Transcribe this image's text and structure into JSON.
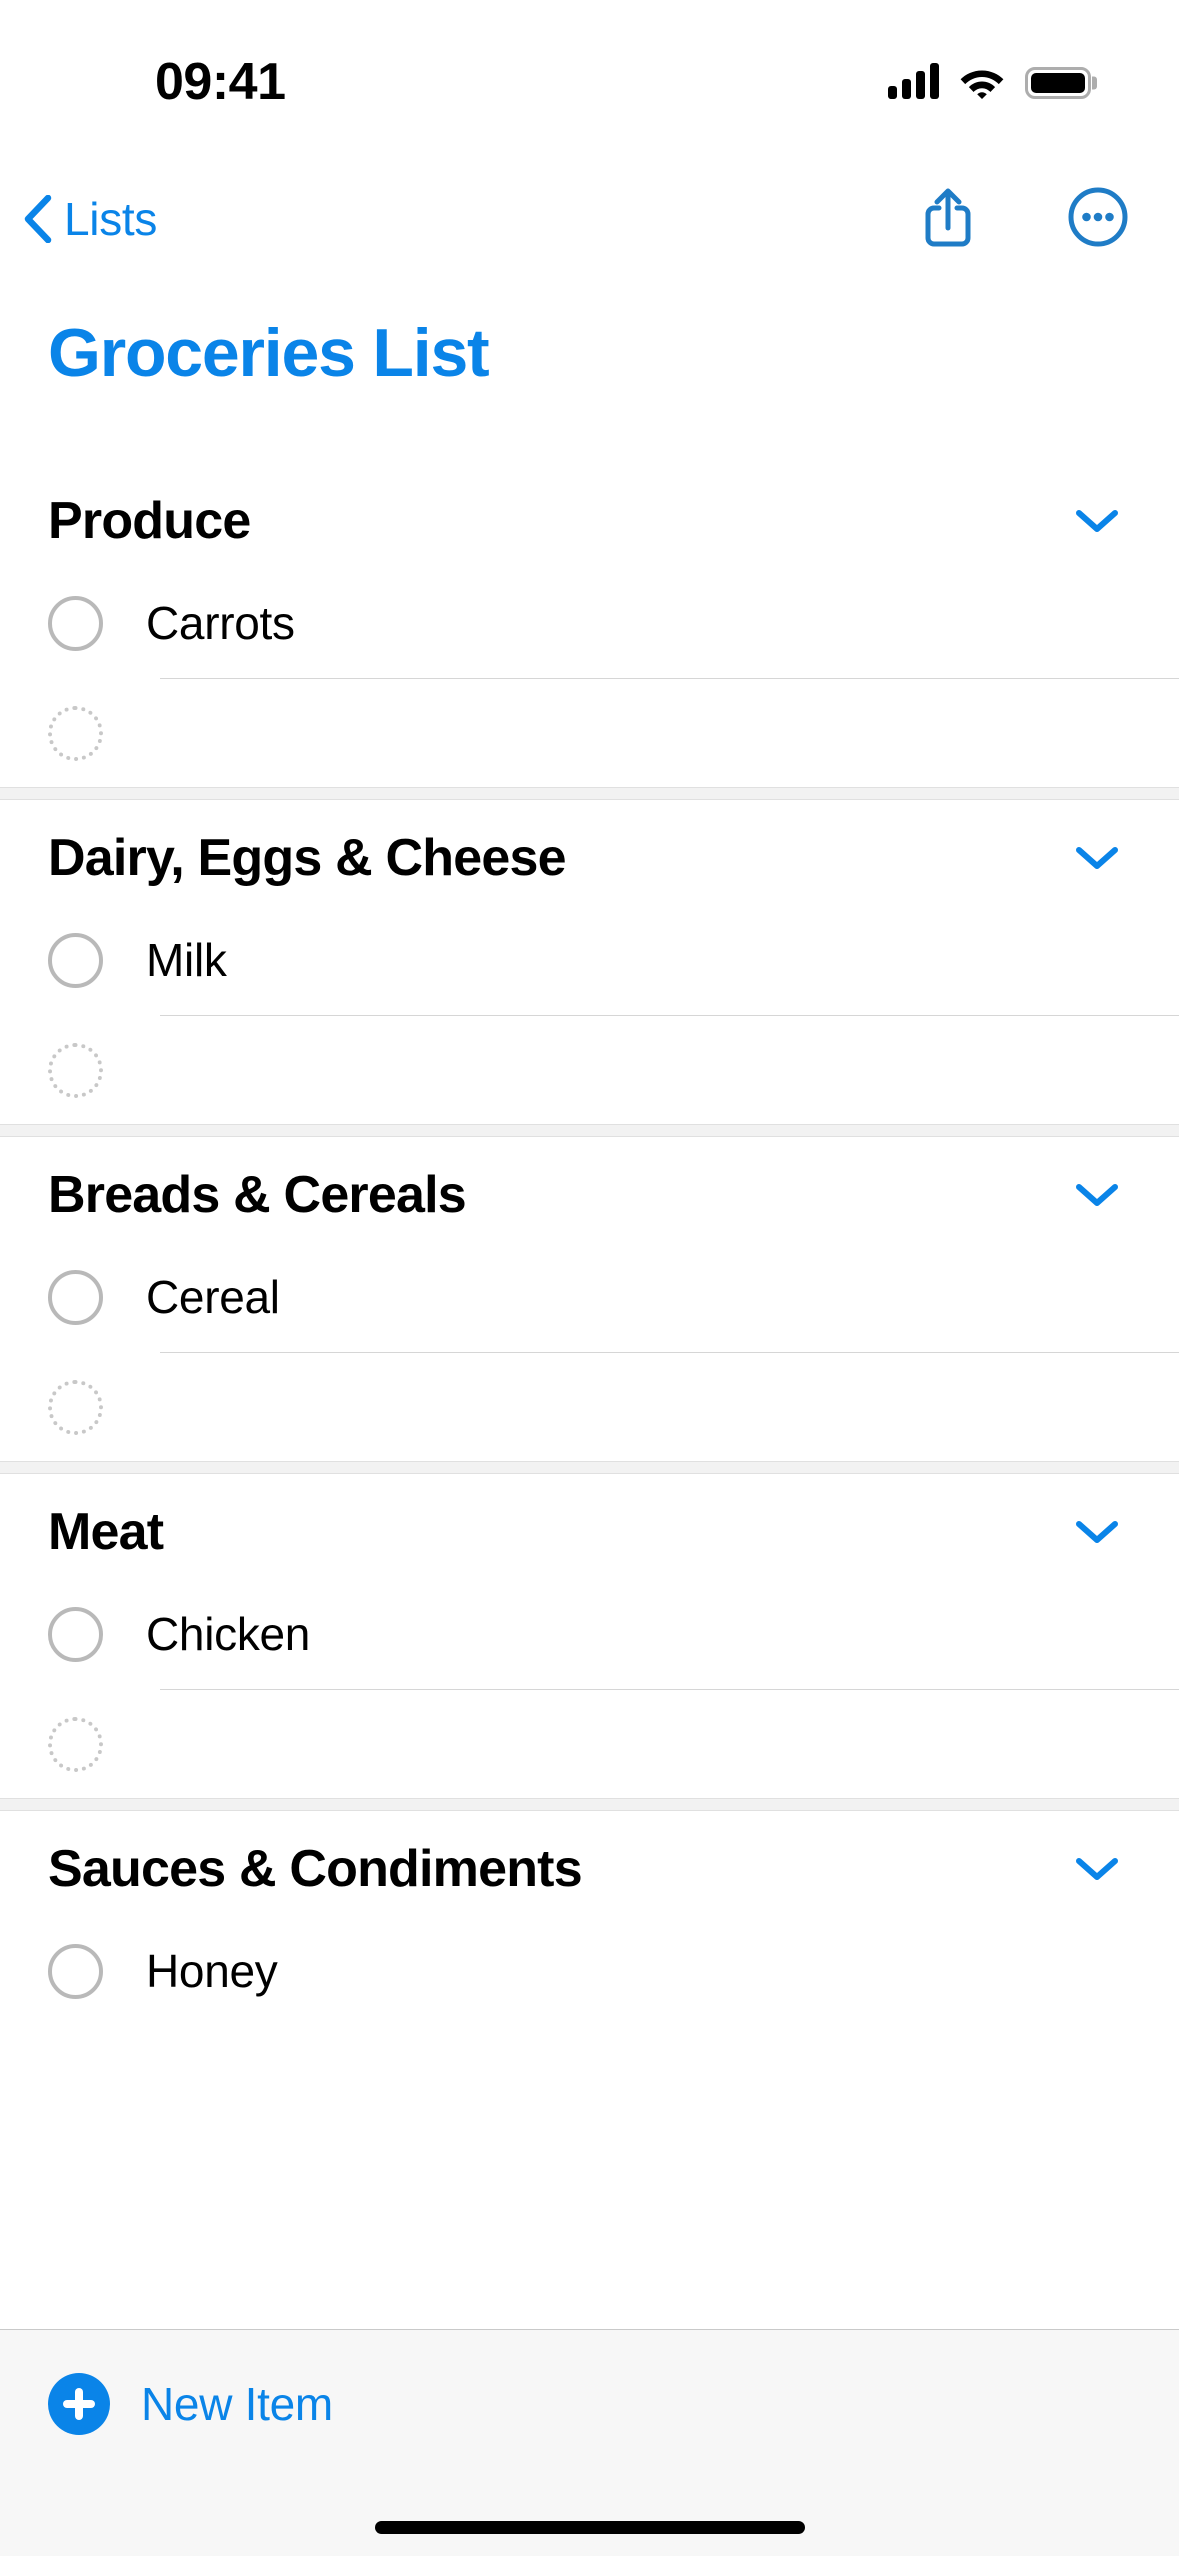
{
  "status_bar": {
    "time": "09:41",
    "signal_icon": "cellular-signal-icon",
    "wifi_icon": "wifi-icon",
    "battery_icon": "battery-full-icon"
  },
  "nav_bar": {
    "back_label": "Lists",
    "back_icon": "chevron-left-icon",
    "share_icon": "share-icon",
    "more_icon": "ellipsis-circle-icon"
  },
  "page_title": "Groceries List",
  "accent_color": "#0a84e8",
  "sections": [
    {
      "title": "Produce",
      "collapse_icon": "chevron-down-icon",
      "items": [
        {
          "label": "Carrots",
          "checked": false
        }
      ],
      "new_row_placeholder": ""
    },
    {
      "title": "Dairy, Eggs & Cheese",
      "collapse_icon": "chevron-down-icon",
      "items": [
        {
          "label": "Milk",
          "checked": false
        }
      ],
      "new_row_placeholder": ""
    },
    {
      "title": "Breads & Cereals",
      "collapse_icon": "chevron-down-icon",
      "items": [
        {
          "label": "Cereal",
          "checked": false
        }
      ],
      "new_row_placeholder": ""
    },
    {
      "title": "Meat",
      "collapse_icon": "chevron-down-icon",
      "items": [
        {
          "label": "Chicken",
          "checked": false
        }
      ],
      "new_row_placeholder": ""
    },
    {
      "title": "Sauces & Condiments",
      "collapse_icon": "chevron-down-icon",
      "items": [
        {
          "label": "Honey",
          "checked": false
        }
      ],
      "new_row_placeholder": ""
    }
  ],
  "toolbar": {
    "new_item_label": "New Item",
    "new_item_icon": "plus-circle-icon"
  }
}
